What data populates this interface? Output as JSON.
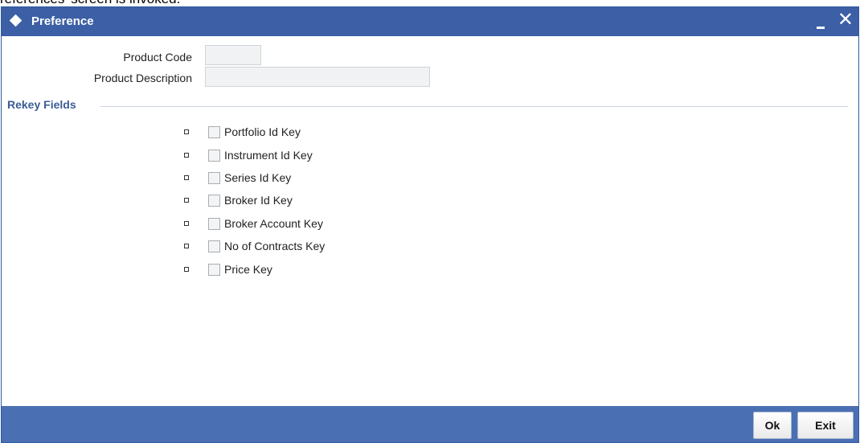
{
  "caption": "references' screen is invoked.",
  "window": {
    "title": "Preference",
    "close_glyph": "✕",
    "diamond_icon": "diamond-icon",
    "minimize_icon": "minimize-icon"
  },
  "fields": {
    "product_code": {
      "label": "Product Code",
      "value": ""
    },
    "product_description": {
      "label": "Product Description",
      "value": ""
    }
  },
  "rekey": {
    "title": "Rekey Fields",
    "items": [
      {
        "label": "Portfolio Id Key",
        "checked": false
      },
      {
        "label": "Instrument Id Key",
        "checked": false
      },
      {
        "label": "Series Id Key",
        "checked": false
      },
      {
        "label": "Broker Id Key",
        "checked": false
      },
      {
        "label": "Broker Account Key",
        "checked": false
      },
      {
        "label": "No of Contracts Key",
        "checked": false
      },
      {
        "label": "Price Key",
        "checked": false
      }
    ]
  },
  "footer": {
    "ok": "Ok",
    "exit": "Exit"
  },
  "colors": {
    "titlebar": "#3c5fa5",
    "footer": "#4a6fb2",
    "section_title": "#3b5c95"
  }
}
